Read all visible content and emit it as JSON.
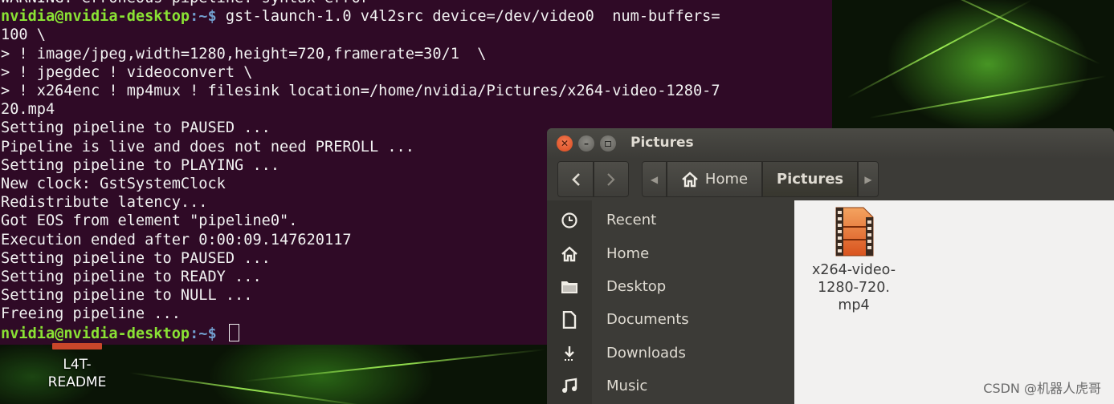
{
  "terminal": {
    "lines": [
      {
        "plain": "WARNING: erroneous pipeline: syntax error"
      },
      {
        "user": "nvidia@nvidia-desktop",
        "path": ":~$",
        "cmd": " gst-launch-1.0 v4l2src device=/dev/video0  num-buffers="
      },
      {
        "plain": "100 \\"
      },
      {
        "plain": "> ! image/jpeg,width=1280,height=720,framerate=30/1  \\"
      },
      {
        "plain": "> ! jpegdec ! videoconvert \\"
      },
      {
        "plain": "> ! x264enc ! mp4mux ! filesink location=/home/nvidia/Pictures/x264-video-1280-7"
      },
      {
        "plain": "20.mp4"
      },
      {
        "plain": "Setting pipeline to PAUSED ..."
      },
      {
        "plain": "Pipeline is live and does not need PREROLL ..."
      },
      {
        "plain": "Setting pipeline to PLAYING ..."
      },
      {
        "plain": "New clock: GstSystemClock"
      },
      {
        "plain": "Redistribute latency..."
      },
      {
        "plain": "Got EOS from element \"pipeline0\"."
      },
      {
        "plain": "Execution ended after 0:00:09.147620117"
      },
      {
        "plain": "Setting pipeline to PAUSED ..."
      },
      {
        "plain": "Setting pipeline to READY ..."
      },
      {
        "plain": "Setting pipeline to NULL ..."
      },
      {
        "plain": "Freeing pipeline ..."
      },
      {
        "user": "nvidia@nvidia-desktop",
        "path": ":~$",
        "cmd": " "
      }
    ],
    "bg_color": "#2f0a26",
    "user_color": "#8ae234",
    "path_color": "#729fcf"
  },
  "desktop": {
    "icon_label_line1": "L4T-",
    "icon_label_line2": "README"
  },
  "file_manager": {
    "title": "Pictures",
    "breadcrumb": {
      "home": "Home",
      "current": "Pictures"
    },
    "sidebar": [
      {
        "label": "Recent",
        "icon": "clock-icon"
      },
      {
        "label": "Home",
        "icon": "home-icon"
      },
      {
        "label": "Desktop",
        "icon": "folder-icon"
      },
      {
        "label": "Documents",
        "icon": "document-icon"
      },
      {
        "label": "Downloads",
        "icon": "download-icon"
      },
      {
        "label": "Music",
        "icon": "music-icon"
      }
    ],
    "files": [
      {
        "label_line1": "x264-video-",
        "label_line2": "1280-720.",
        "label_line3": "mp4",
        "icon": "video-file-icon"
      }
    ]
  },
  "watermark": "CSDN @机器人虎哥"
}
